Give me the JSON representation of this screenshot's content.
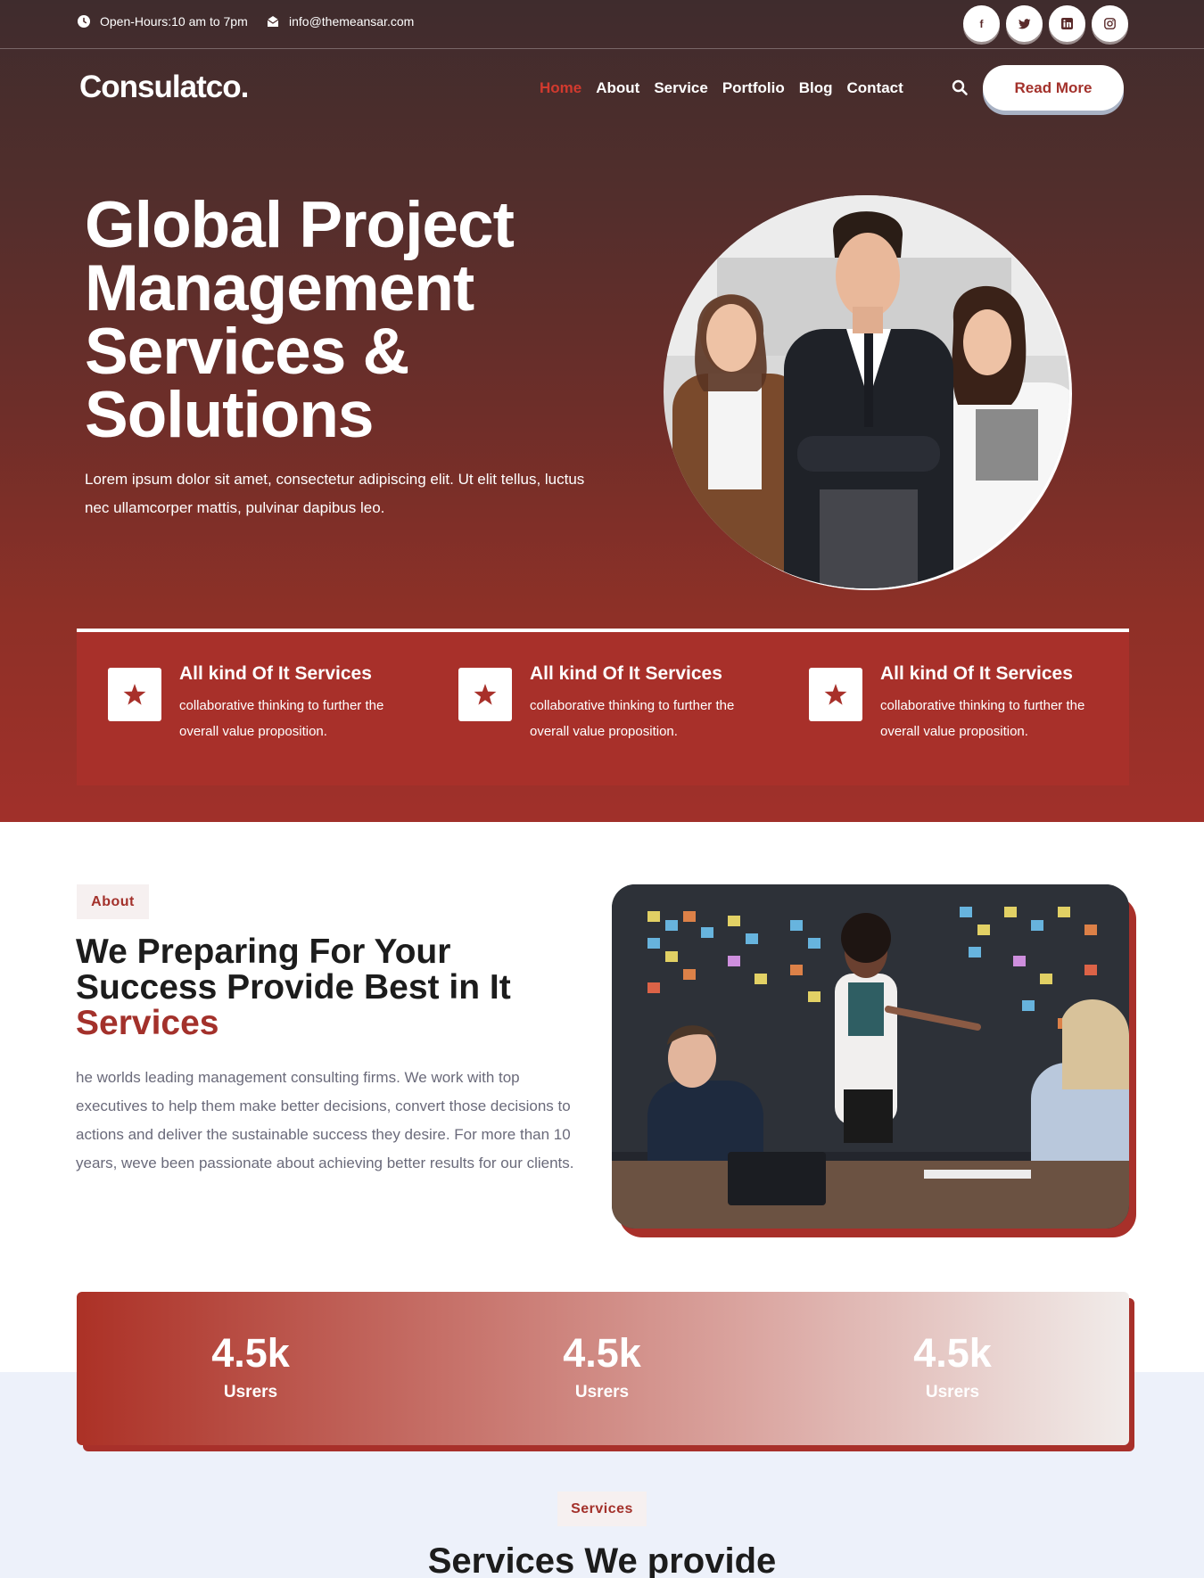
{
  "topbar": {
    "hours": "Open-Hours:10 am to 7pm",
    "email": "info@themeansar.com",
    "social": [
      {
        "icon": "facebook-icon",
        "glyph": "f"
      },
      {
        "icon": "twitter-icon",
        "glyph": "t"
      },
      {
        "icon": "linkedin-icon",
        "glyph": "in"
      },
      {
        "icon": "instagram-icon",
        "glyph": "ig"
      }
    ]
  },
  "header": {
    "logo": "Consulatco.",
    "nav": [
      "Home",
      "About",
      "Service",
      "Portfolio",
      "Blog",
      "Contact"
    ],
    "active_nav": "Home",
    "cta": "Read More"
  },
  "hero": {
    "title": "Global Project Management Services & Solutions",
    "description": "Lorem ipsum dolor sit amet, consectetur adipiscing elit. Ut elit tellus, luctus nec ullamcorper mattis, pulvinar dapibus leo."
  },
  "features": [
    {
      "title": "All kind Of It Services",
      "text": "collaborative thinking to further the overall value proposition."
    },
    {
      "title": "All kind Of It Services",
      "text": "collaborative thinking to further the overall value proposition."
    },
    {
      "title": "All kind Of It Services",
      "text": "collaborative thinking to further the overall value proposition."
    }
  ],
  "about": {
    "tag": "About",
    "title": "We Preparing For Your Success Provide Best in It",
    "title_accent": "Services",
    "description": "he worlds leading management consulting firms. We work with top executives to help them make better decisions, convert those decisions to actions and deliver the sustainable success they desire. For more than 10 years, weve been passionate about achieving better results for our clients."
  },
  "stats": [
    {
      "value": "4.5k",
      "label": "Usrers"
    },
    {
      "value": "4.5k",
      "label": "Usrers"
    },
    {
      "value": "4.5k",
      "label": "Usrers"
    }
  ],
  "services": {
    "tag": "Services",
    "title": "Services We provide"
  },
  "colors": {
    "brand": "#a8302a",
    "active_nav": "#d23a2e",
    "hero_top": "#3f2c2d",
    "lower_bg": "#edf1fa"
  }
}
